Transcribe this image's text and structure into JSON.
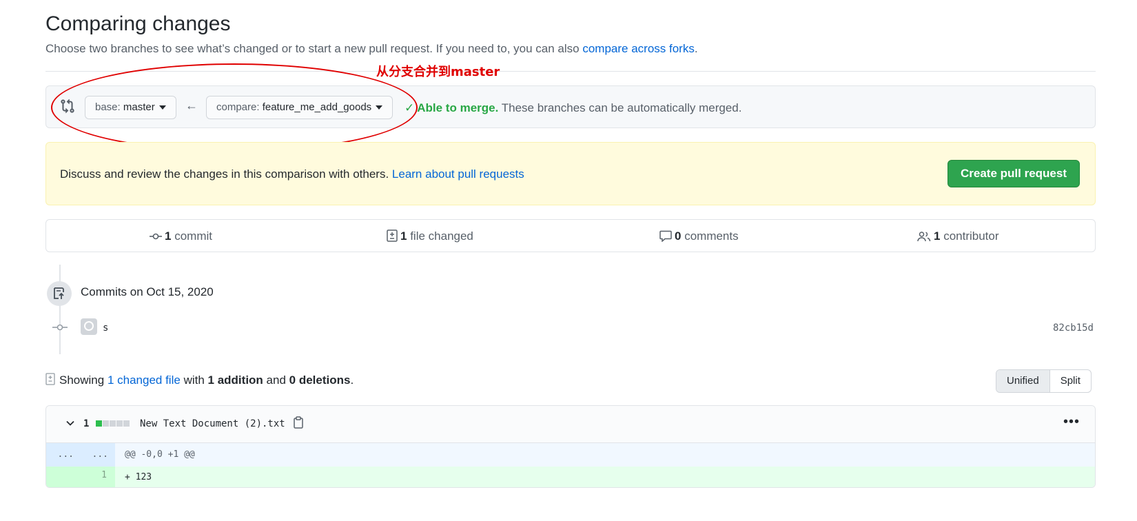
{
  "header": {
    "title": "Comparing changes",
    "subtitle": "Choose two branches to see what’s changed or to start a new pull request. If you need to, you can also",
    "subtitle_link": "compare across forks",
    "subtitle_end": "."
  },
  "annotation": {
    "text": "从分支合并到master",
    "color": "#e00000"
  },
  "range": {
    "base_prefix": "base:",
    "base_branch": "master",
    "compare_prefix": "compare:",
    "compare_branch": "feature_me_add_goods",
    "merge_check": "✓",
    "merge_status": "Able to merge.",
    "merge_message": "These branches can be automatically merged."
  },
  "notice": {
    "text": "Discuss and review the changes in this comparison with others.",
    "link": "Learn about pull requests",
    "button": "Create pull request"
  },
  "stats": {
    "commits_count": "1",
    "commits_label": "commit",
    "files_count": "1",
    "files_label": "file changed",
    "comments_count": "0",
    "comments_label": "comments",
    "contributors_count": "1",
    "contributors_label": "contributor"
  },
  "timeline": {
    "date_label": "Commits on Oct 15, 2020",
    "commit_message": "s",
    "commit_sha": "82cb15d"
  },
  "summary": {
    "showing": "Showing",
    "changed_link": "1 changed file",
    "with": "with",
    "additions": "1 addition",
    "and": "and",
    "deletions": "0 deletions",
    "end": "."
  },
  "view_toggle": {
    "unified": "Unified",
    "split": "Split",
    "active": "Unified"
  },
  "file": {
    "change_count": "1",
    "name": "New Text Document (2).txt",
    "diffstat": [
      "added",
      "neutral",
      "neutral",
      "neutral",
      "neutral"
    ],
    "hunk_left": "...",
    "hunk_right": "...",
    "hunk_header": "@@ -0,0 +1 @@",
    "line_number": "1",
    "line_text": "+ 123"
  },
  "colors": {
    "accent_link": "#0366d6",
    "success": "#28a745",
    "button_green": "#2ea44f",
    "notice_bg": "#fffbdd"
  }
}
